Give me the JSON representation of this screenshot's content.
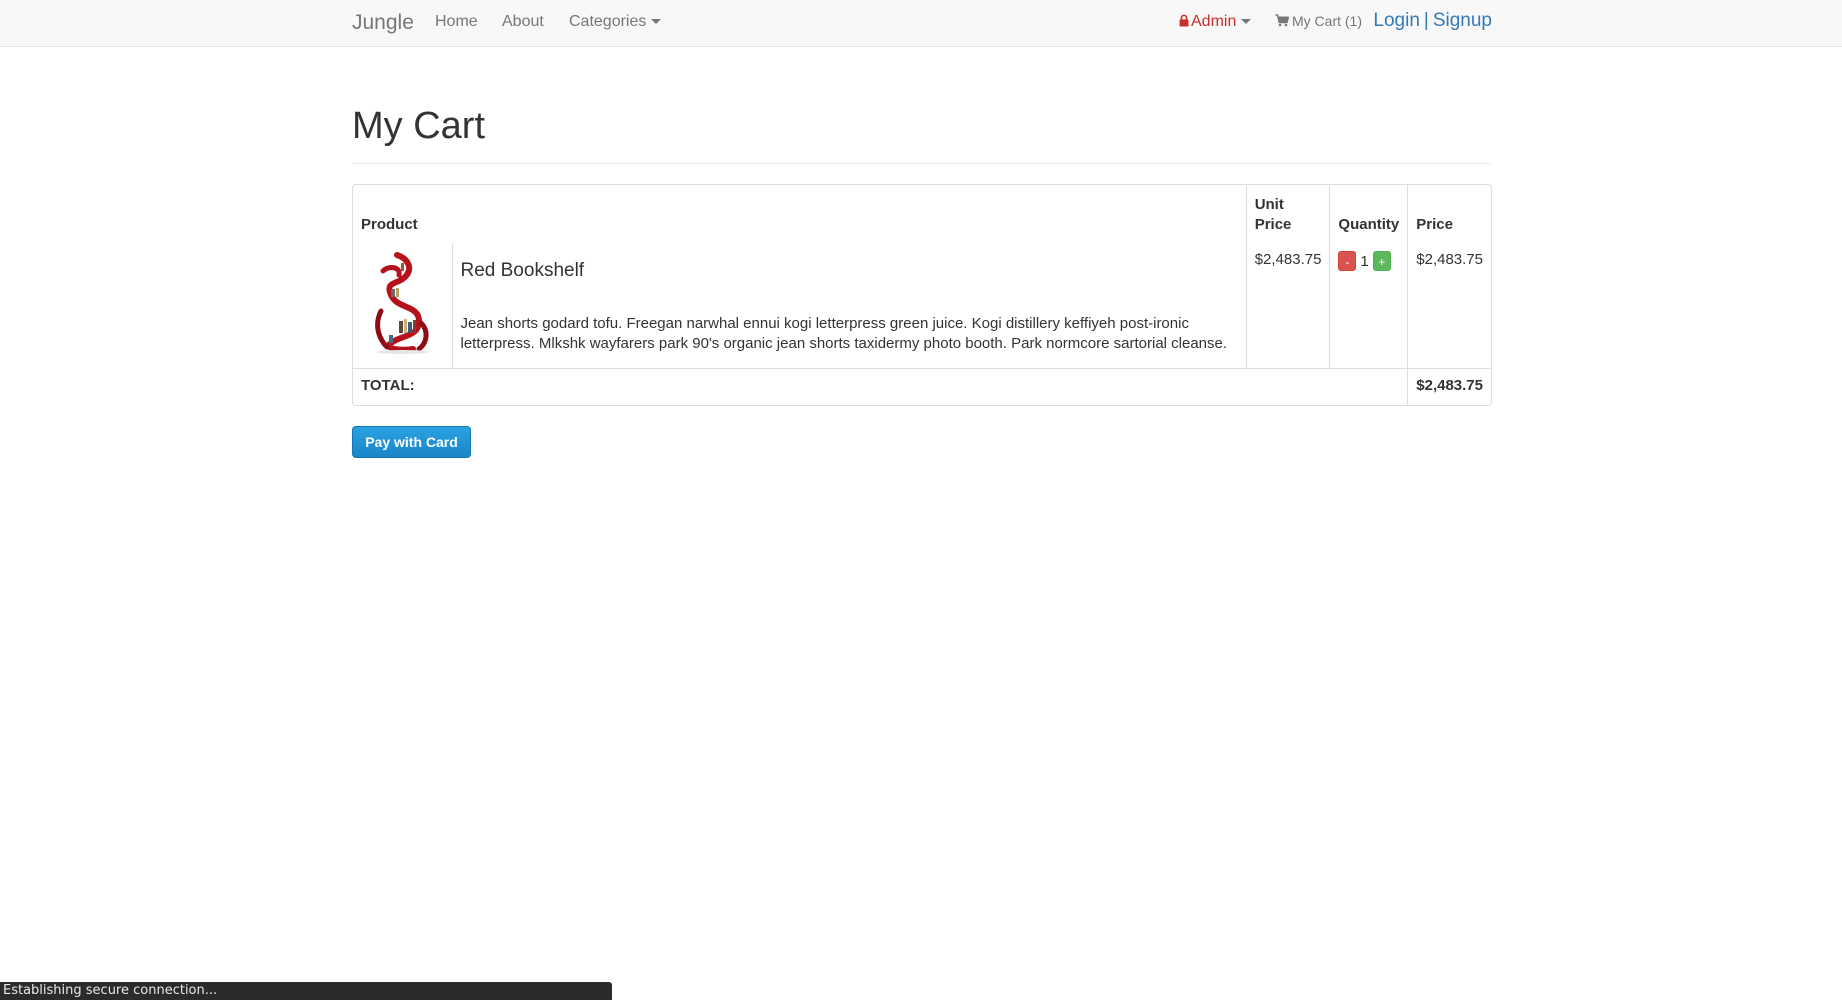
{
  "navbar": {
    "brand": "Jungle",
    "links": [
      "Home",
      "About"
    ],
    "categories_label": "Categories",
    "admin_label": "Admin",
    "cart_label": "My Cart (1)",
    "login_label": "Login",
    "separator": "|",
    "signup_label": "Signup"
  },
  "page": {
    "title": "My Cart"
  },
  "cart_table": {
    "headers": {
      "product": "Product",
      "unit_price": "Unit Price",
      "quantity": "Quantity",
      "price": "Price"
    },
    "items": [
      {
        "name": "Red Bookshelf",
        "description": "Jean shorts godard tofu. Freegan narwhal ennui kogi letterpress green juice. Kogi distillery keffiyeh post-ironic letterpress. Mlkshk wayfarers park 90's organic jean shorts taxidermy photo booth. Park normcore sartorial cleanse.",
        "unit_price": "$2,483.75",
        "decrement_label": "-",
        "quantity": "1",
        "increment_label": "+",
        "price": "$2,483.75",
        "image_icon": "red-bookshelf-image"
      }
    ],
    "total_label": "TOTAL:",
    "total_value": "$2,483.75"
  },
  "actions": {
    "pay_label": "Pay with Card"
  },
  "status_bar": {
    "text": "Establishing secure connection..."
  },
  "colors": {
    "link": "#337ab7",
    "admin": "#c9302c",
    "minus_button": "#d9534f",
    "plus_button": "#5cb85c",
    "pay_button": "#1a84c7"
  }
}
